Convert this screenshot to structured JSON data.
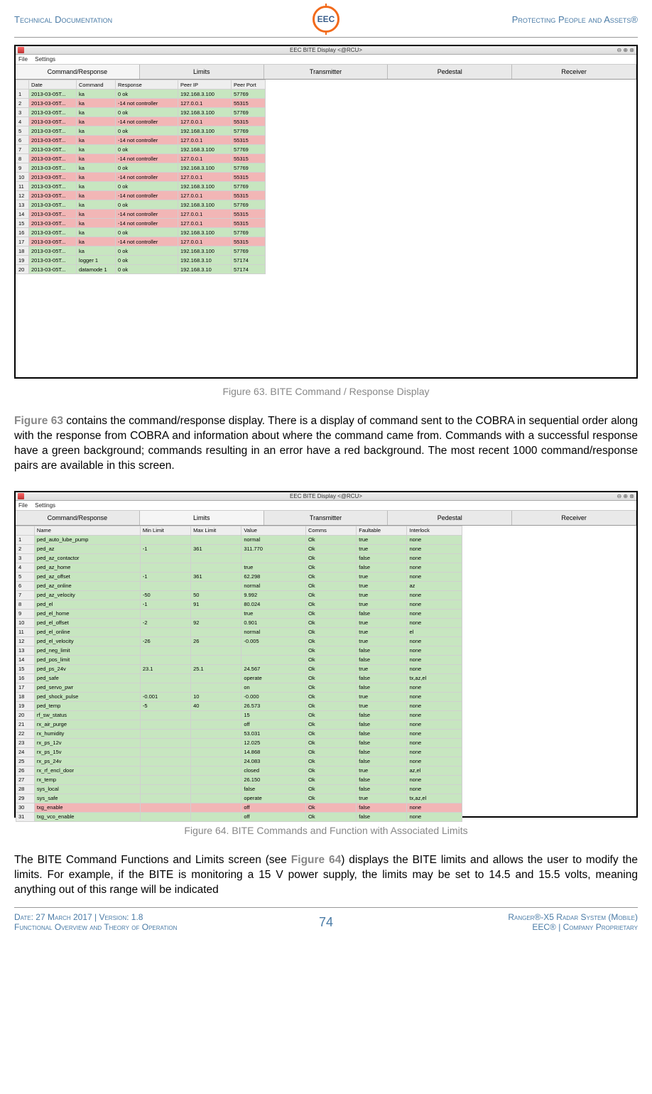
{
  "header": {
    "left": "Technical Documentation",
    "right": "Protecting People and Assets®",
    "logo_text": "EEC"
  },
  "app1": {
    "title": "EEC BITE Display <@RCU>",
    "menu": [
      "File",
      "Settings"
    ],
    "tabs": [
      "Command/Response",
      "Limits",
      "Transmitter",
      "Pedestal",
      "Receiver"
    ],
    "columns": [
      "",
      "Date",
      "Command",
      "Response",
      "Peer IP",
      "Peer Port"
    ],
    "rows": [
      {
        "n": "1",
        "date": "2013-03-05T...",
        "cmd": "ka",
        "resp": "0 ok",
        "ip": "192.168.3.100",
        "port": "57769",
        "ok": true
      },
      {
        "n": "2",
        "date": "2013-03-05T...",
        "cmd": "ka",
        "resp": "-14 not controller",
        "ip": "127.0.0.1",
        "port": "55315",
        "ok": false
      },
      {
        "n": "3",
        "date": "2013-03-05T...",
        "cmd": "ka",
        "resp": "0 ok",
        "ip": "192.168.3.100",
        "port": "57769",
        "ok": true
      },
      {
        "n": "4",
        "date": "2013-03-05T...",
        "cmd": "ka",
        "resp": "-14 not controller",
        "ip": "127.0.0.1",
        "port": "55315",
        "ok": false
      },
      {
        "n": "5",
        "date": "2013-03-05T...",
        "cmd": "ka",
        "resp": "0 ok",
        "ip": "192.168.3.100",
        "port": "57769",
        "ok": true
      },
      {
        "n": "6",
        "date": "2013-03-05T...",
        "cmd": "ka",
        "resp": "-14 not controller",
        "ip": "127.0.0.1",
        "port": "55315",
        "ok": false
      },
      {
        "n": "7",
        "date": "2013-03-05T...",
        "cmd": "ka",
        "resp": "0 ok",
        "ip": "192.168.3.100",
        "port": "57769",
        "ok": true
      },
      {
        "n": "8",
        "date": "2013-03-05T...",
        "cmd": "ka",
        "resp": "-14 not controller",
        "ip": "127.0.0.1",
        "port": "55315",
        "ok": false
      },
      {
        "n": "9",
        "date": "2013-03-05T...",
        "cmd": "ka",
        "resp": "0 ok",
        "ip": "192.168.3.100",
        "port": "57769",
        "ok": true
      },
      {
        "n": "10",
        "date": "2013-03-05T...",
        "cmd": "ka",
        "resp": "-14 not controller",
        "ip": "127.0.0.1",
        "port": "55315",
        "ok": false
      },
      {
        "n": "11",
        "date": "2013-03-05T...",
        "cmd": "ka",
        "resp": "0 ok",
        "ip": "192.168.3.100",
        "port": "57769",
        "ok": true
      },
      {
        "n": "12",
        "date": "2013-03-05T...",
        "cmd": "ka",
        "resp": "-14 not controller",
        "ip": "127.0.0.1",
        "port": "55315",
        "ok": false
      },
      {
        "n": "13",
        "date": "2013-03-05T...",
        "cmd": "ka",
        "resp": "0 ok",
        "ip": "192.168.3.100",
        "port": "57769",
        "ok": true
      },
      {
        "n": "14",
        "date": "2013-03-05T...",
        "cmd": "ka",
        "resp": "-14 not controller",
        "ip": "127.0.0.1",
        "port": "55315",
        "ok": false
      },
      {
        "n": "15",
        "date": "2013-03-05T...",
        "cmd": "ka",
        "resp": "-14 not controller",
        "ip": "127.0.0.1",
        "port": "55315",
        "ok": false
      },
      {
        "n": "16",
        "date": "2013-03-05T...",
        "cmd": "ka",
        "resp": "0 ok",
        "ip": "192.168.3.100",
        "port": "57769",
        "ok": true
      },
      {
        "n": "17",
        "date": "2013-03-05T...",
        "cmd": "ka",
        "resp": "-14 not controller",
        "ip": "127.0.0.1",
        "port": "55315",
        "ok": false
      },
      {
        "n": "18",
        "date": "2013-03-05T...",
        "cmd": "ka",
        "resp": "0 ok",
        "ip": "192.168.3.100",
        "port": "57769",
        "ok": true
      },
      {
        "n": "19",
        "date": "2013-03-05T...",
        "cmd": "logger 1",
        "resp": "0 ok",
        "ip": "192.168.3.10",
        "port": "57174",
        "ok": true
      },
      {
        "n": "20",
        "date": "2013-03-05T...",
        "cmd": "datamode 1",
        "resp": "0 ok",
        "ip": "192.168.3.10",
        "port": "57174",
        "ok": true
      }
    ]
  },
  "caption1": "Figure 63. BITE Command / Response Display",
  "para1_prefix": "Figure 63",
  "para1": " contains the command/response display.  There is a display of command sent to the COBRA in sequential order along with the response from COBRA and information about where the command came from.  Commands with a successful response have a green background; commands resulting in an error have a red background.  The most recent 1000 command/response pairs are available in this screen.",
  "app2": {
    "title": "EEC BITE Display <@RCU>",
    "menu": [
      "File",
      "Settings"
    ],
    "tabs": [
      "Command/Response",
      "Limits",
      "Transmitter",
      "Pedestal",
      "Receiver"
    ],
    "columns": [
      "",
      "Name",
      "Min Limit",
      "Max Limit",
      "Value",
      "Comms",
      "Faultable",
      "Interlock"
    ],
    "rows": [
      {
        "n": "1",
        "name": "ped_auto_lube_pump",
        "min": "",
        "max": "",
        "val": "normal",
        "comms": "Ok",
        "fault": "true",
        "intl": "none",
        "ok": true,
        "hmin": true,
        "hmax": true
      },
      {
        "n": "2",
        "name": "ped_az",
        "min": "-1",
        "max": "361",
        "val": "311.770",
        "comms": "Ok",
        "fault": "true",
        "intl": "none",
        "ok": true
      },
      {
        "n": "3",
        "name": "ped_az_contactor",
        "min": "",
        "max": "",
        "val": "",
        "comms": "Ok",
        "fault": "false",
        "intl": "none",
        "ok": true,
        "hmin": true,
        "hmax": true
      },
      {
        "n": "4",
        "name": "ped_az_home",
        "min": "",
        "max": "",
        "val": "true",
        "comms": "Ok",
        "fault": "false",
        "intl": "none",
        "ok": true,
        "hmin": true,
        "hmax": true
      },
      {
        "n": "5",
        "name": "ped_az_offset",
        "min": "-1",
        "max": "361",
        "val": "62.298",
        "comms": "Ok",
        "fault": "true",
        "intl": "none",
        "ok": true
      },
      {
        "n": "6",
        "name": "ped_az_online",
        "min": "",
        "max": "",
        "val": "normal",
        "comms": "Ok",
        "fault": "true",
        "intl": "az",
        "ok": true,
        "hmin": true,
        "hmax": true
      },
      {
        "n": "7",
        "name": "ped_az_velocity",
        "min": "-50",
        "max": "50",
        "val": "9.992",
        "comms": "Ok",
        "fault": "true",
        "intl": "none",
        "ok": true
      },
      {
        "n": "8",
        "name": "ped_el",
        "min": "-1",
        "max": "91",
        "val": "80.024",
        "comms": "Ok",
        "fault": "true",
        "intl": "none",
        "ok": true
      },
      {
        "n": "9",
        "name": "ped_el_home",
        "min": "",
        "max": "",
        "val": "true",
        "comms": "Ok",
        "fault": "false",
        "intl": "none",
        "ok": true,
        "hmin": true,
        "hmax": true
      },
      {
        "n": "10",
        "name": "ped_el_offset",
        "min": "-2",
        "max": "92",
        "val": "0.901",
        "comms": "Ok",
        "fault": "true",
        "intl": "none",
        "ok": true
      },
      {
        "n": "11",
        "name": "ped_el_online",
        "min": "",
        "max": "",
        "val": "normal",
        "comms": "Ok",
        "fault": "true",
        "intl": "el",
        "ok": true,
        "hmin": true,
        "hmax": true
      },
      {
        "n": "12",
        "name": "ped_el_velocity",
        "min": "-26",
        "max": "26",
        "val": "-0.005",
        "comms": "Ok",
        "fault": "true",
        "intl": "none",
        "ok": true
      },
      {
        "n": "13",
        "name": "ped_neg_limit",
        "min": "",
        "max": "",
        "val": "",
        "comms": "Ok",
        "fault": "false",
        "intl": "none",
        "ok": true,
        "hmin": true,
        "hmax": true
      },
      {
        "n": "14",
        "name": "ped_pos_limit",
        "min": "",
        "max": "",
        "val": "",
        "comms": "Ok",
        "fault": "false",
        "intl": "none",
        "ok": true,
        "hmin": true,
        "hmax": true
      },
      {
        "n": "15",
        "name": "ped_ps_24v",
        "min": "23.1",
        "max": "25.1",
        "val": "24.567",
        "comms": "Ok",
        "fault": "true",
        "intl": "none",
        "ok": true
      },
      {
        "n": "16",
        "name": "ped_safe",
        "min": "",
        "max": "",
        "val": "operate",
        "comms": "Ok",
        "fault": "false",
        "intl": "tx,az,el",
        "ok": true,
        "hmin": true,
        "hmax": true
      },
      {
        "n": "17",
        "name": "ped_servo_pwr",
        "min": "",
        "max": "",
        "val": "on",
        "comms": "Ok",
        "fault": "false",
        "intl": "none",
        "ok": true,
        "hmin": true,
        "hmax": true
      },
      {
        "n": "18",
        "name": "ped_shock_pulse",
        "min": "-0.001",
        "max": "10",
        "val": "-0.000",
        "comms": "Ok",
        "fault": "true",
        "intl": "none",
        "ok": true
      },
      {
        "n": "19",
        "name": "ped_temp",
        "min": "-5",
        "max": "40",
        "val": "26.573",
        "comms": "Ok",
        "fault": "true",
        "intl": "none",
        "ok": true
      },
      {
        "n": "20",
        "name": "rf_sw_status",
        "min": "",
        "max": "",
        "val": "15",
        "comms": "Ok",
        "fault": "false",
        "intl": "none",
        "ok": true,
        "hmin": true,
        "hmax": true
      },
      {
        "n": "21",
        "name": "rx_air_purge",
        "min": "",
        "max": "",
        "val": "off",
        "comms": "Ok",
        "fault": "false",
        "intl": "none",
        "ok": true,
        "hmin": true,
        "hmax": true
      },
      {
        "n": "22",
        "name": "rx_humidity",
        "min": "",
        "max": "",
        "val": "53.031",
        "comms": "Ok",
        "fault": "false",
        "intl": "none",
        "ok": true,
        "hmin": true,
        "hmax": true
      },
      {
        "n": "23",
        "name": "rx_ps_12v",
        "min": "",
        "max": "",
        "val": "12.025",
        "comms": "Ok",
        "fault": "false",
        "intl": "none",
        "ok": true,
        "hmin": true,
        "hmax": true
      },
      {
        "n": "24",
        "name": "rx_ps_15v",
        "min": "",
        "max": "",
        "val": "14.868",
        "comms": "Ok",
        "fault": "false",
        "intl": "none",
        "ok": true,
        "hmin": true,
        "hmax": true
      },
      {
        "n": "25",
        "name": "rx_ps_24v",
        "min": "",
        "max": "",
        "val": "24.083",
        "comms": "Ok",
        "fault": "false",
        "intl": "none",
        "ok": true,
        "hmin": true,
        "hmax": true
      },
      {
        "n": "26",
        "name": "rx_rf_encl_door",
        "min": "",
        "max": "",
        "val": "closed",
        "comms": "Ok",
        "fault": "true",
        "intl": "az,el",
        "ok": true,
        "hmin": true,
        "hmax": true
      },
      {
        "n": "27",
        "name": "rx_temp",
        "min": "",
        "max": "",
        "val": "26.150",
        "comms": "Ok",
        "fault": "false",
        "intl": "none",
        "ok": true,
        "hmin": true,
        "hmax": true
      },
      {
        "n": "28",
        "name": "sys_local",
        "min": "",
        "max": "",
        "val": "false",
        "comms": "Ok",
        "fault": "false",
        "intl": "none",
        "ok": true,
        "hmin": true,
        "hmax": true
      },
      {
        "n": "29",
        "name": "sys_safe",
        "min": "",
        "max": "",
        "val": "operate",
        "comms": "Ok",
        "fault": "true",
        "intl": "tx,az,el",
        "ok": true,
        "hmin": true,
        "hmax": true
      },
      {
        "n": "30",
        "name": "txg_enable",
        "min": "",
        "max": "",
        "val": "off",
        "comms": "Ok",
        "fault": "false",
        "intl": "none",
        "ok": false,
        "hmin": true,
        "hmax": true
      },
      {
        "n": "31",
        "name": "txg_vco_enable",
        "min": "",
        "max": "",
        "val": "off",
        "comms": "Ok",
        "fault": "false",
        "intl": "none",
        "ok": true,
        "hmin": true,
        "hmax": true
      }
    ]
  },
  "caption2": "Figure 64. BITE Commands and Function with Associated Limits",
  "para2_a": "The BITE Command Functions and Limits screen (see ",
  "para2_ref": "Figure 64",
  "para2_b": ") displays the BITE limits and allows the user to modify the limits.  For example, if the BITE is monitoring a 15 V power supply, the limits may be set to 14.5 and 15.5 volts, meaning anything out of this range will be indicated",
  "footer": {
    "left1": "Date: 27 March 2017 | Version: 1.8",
    "left2": "Functional Overview and Theory of Operation",
    "page": "74",
    "right1": "Ranger®-X5 Radar System (Mobile)",
    "right2": "EEC® | Company Proprietary"
  }
}
